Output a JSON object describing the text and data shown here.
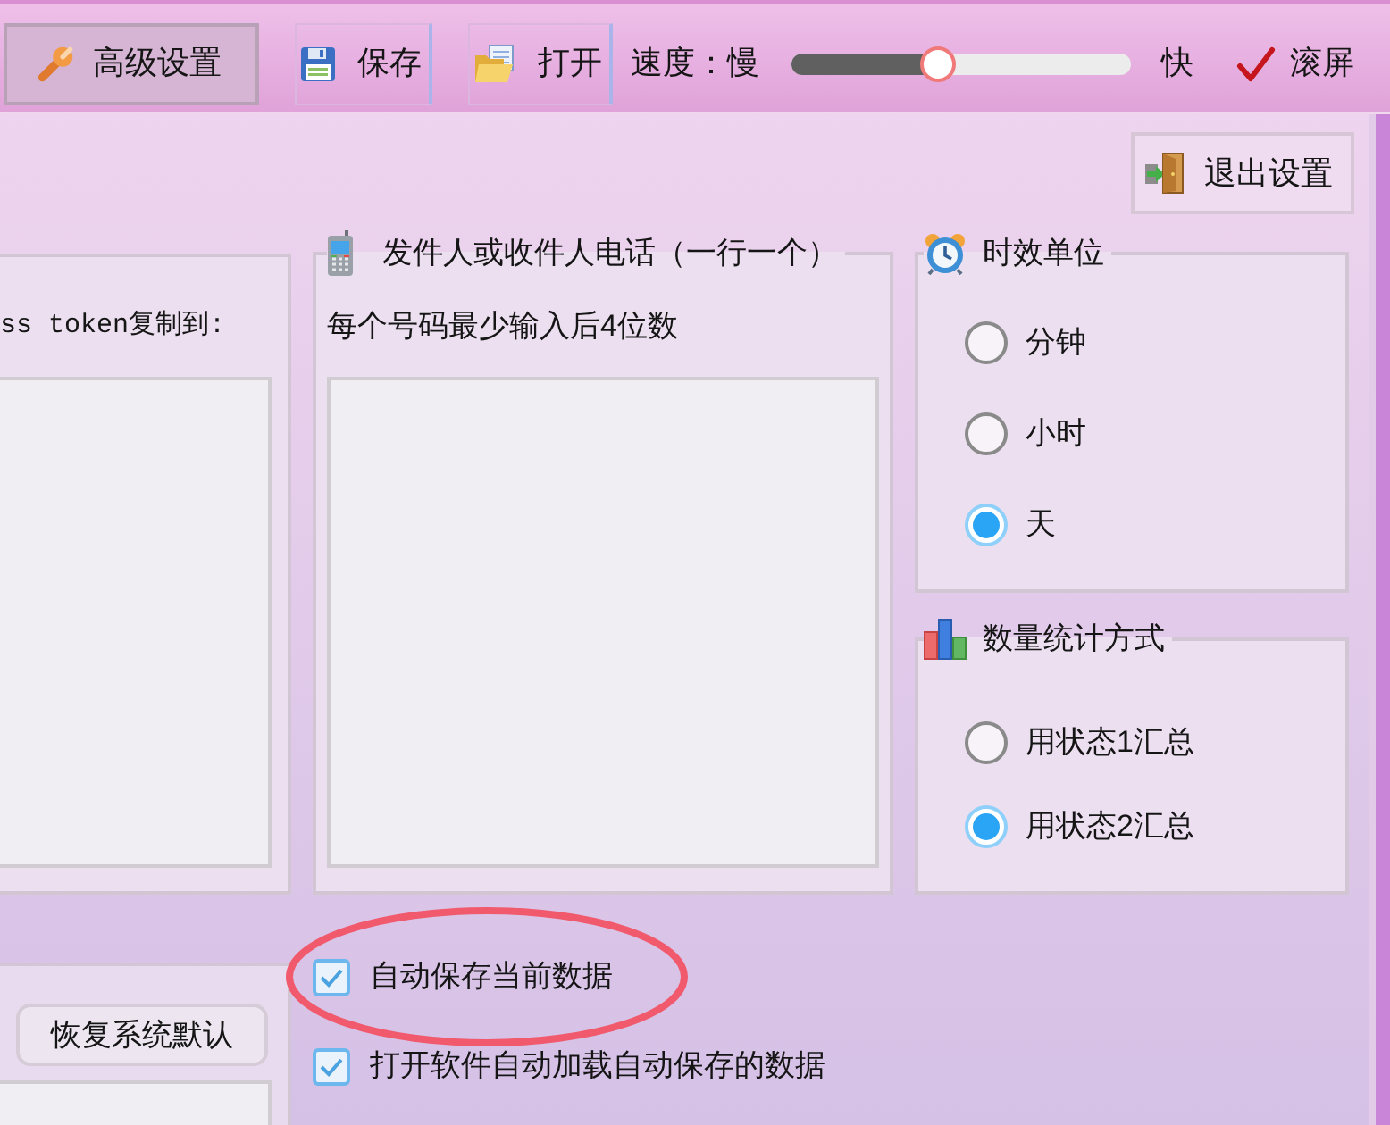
{
  "toolbar": {
    "buttons": [
      {
        "label": "高级设置",
        "selected": true
      },
      {
        "label": "保存",
        "selected": false
      },
      {
        "label": "打开",
        "selected": false
      }
    ],
    "speed": {
      "label": "速度：慢",
      "level": 0.43,
      "max_label": "快"
    },
    "scroll_toggle": {
      "label": "滚屏",
      "checked": true
    }
  },
  "exit_button": {
    "label": "退出设置"
  },
  "token_group": {
    "label": "ss token复制到:"
  },
  "phone_group": {
    "title": "发件人或收件人电话（一行一个）",
    "note": "每个号码最少输入后4位数"
  },
  "time_unit_group": {
    "title": "时效单位",
    "options": [
      {
        "label": "分钟",
        "selected": false
      },
      {
        "label": "小时",
        "selected": false
      },
      {
        "label": "天",
        "selected": true
      }
    ]
  },
  "count_method_group": {
    "title": "数量统计方式",
    "options": [
      {
        "label": "用状态1汇总",
        "selected": false
      },
      {
        "label": "用状态2汇总",
        "selected": true
      }
    ]
  },
  "restore_button": {
    "label": "恢复系统默认"
  },
  "checkboxes": [
    {
      "label": "自动保存当前数据",
      "checked": true,
      "highlighted": true
    },
    {
      "label": "打开软件自动加载自动保存的数据",
      "checked": true,
      "highlighted": false
    }
  ]
}
